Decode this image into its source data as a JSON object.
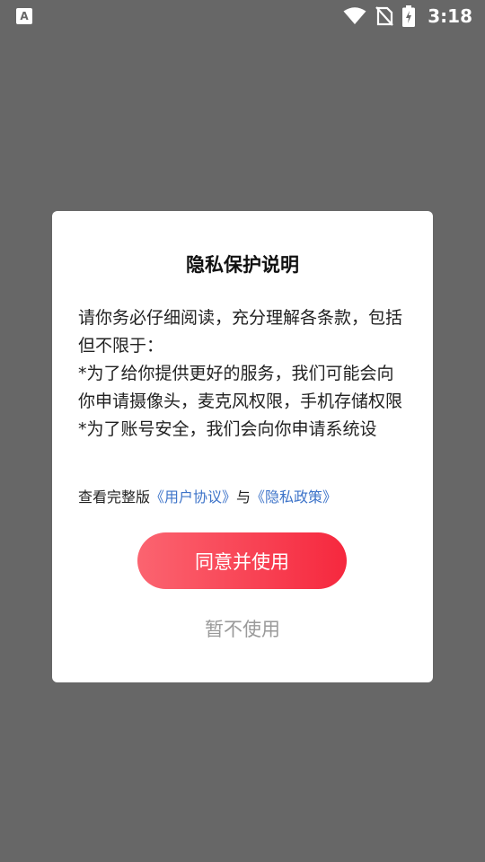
{
  "status_bar": {
    "app_badge": "A",
    "time": "3:18"
  },
  "dialog": {
    "title": "隐私保护说明",
    "body_paragraphs": [
      "请你务必仔细阅读，充分理解各条款，包括但不限于：",
      "*为了给你提供更好的服务，我们可能会向你申请摄像头，麦克风权限，手机存储权限",
      "*为了账号安全，我们会向你申请系统设"
    ],
    "links_line": {
      "prefix": "查看完整版",
      "user_agreement": "《用户协议》",
      "connector": "与",
      "privacy_policy": "《隐私政策》"
    },
    "agree_button": "同意并使用",
    "decline_button": "暂不使用"
  },
  "colors": {
    "overlay": "#676767",
    "link": "#3e74c9",
    "button_gradient_start": "#fb6470",
    "button_gradient_end": "#f6283e",
    "decline_text": "#9a9a9a"
  }
}
